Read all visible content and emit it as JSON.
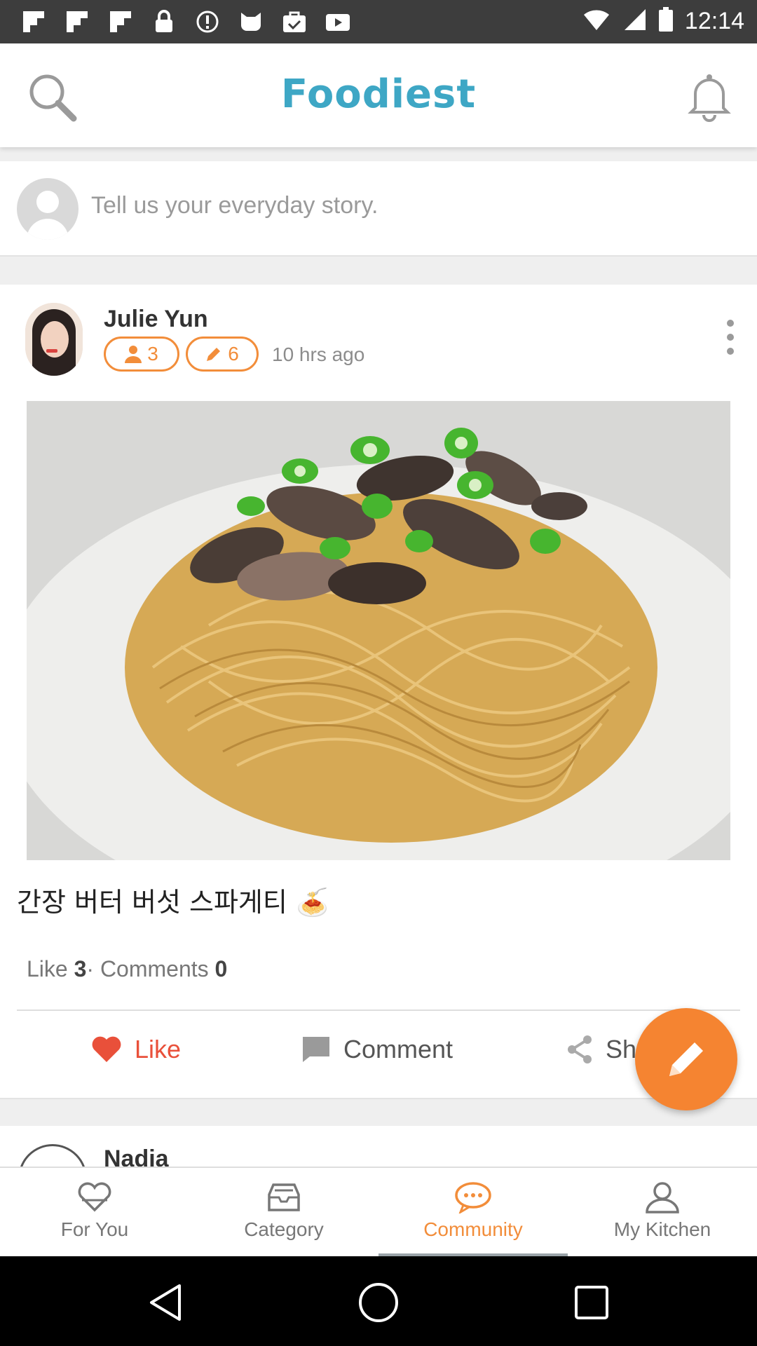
{
  "status_bar": {
    "time": "12:14",
    "notification_icons": [
      "flipboard-icon",
      "flipboard-icon",
      "flipboard-icon",
      "lock-icon",
      "info-icon",
      "cat-icon",
      "bag-icon",
      "youtube-icon"
    ],
    "system_icons": [
      "wifi-icon",
      "signal-icon",
      "battery-icon"
    ]
  },
  "header": {
    "logo_text": "Foodiest",
    "search_icon": "search-icon",
    "bell_icon": "bell-icon",
    "brand_color": "#3ea7c5"
  },
  "composer": {
    "placeholder": "Tell us your everyday story."
  },
  "post": {
    "author_name": "Julie Yun",
    "followers_count": "3",
    "posts_count": "6",
    "timestamp": "10 hrs ago",
    "caption": "간장 버터 버섯 스파게티",
    "caption_emoji": "🍝",
    "stats": {
      "like_label": "Like",
      "like_count": "3",
      "separator": "·",
      "comments_label": "Comments",
      "comments_count": "0"
    },
    "actions": {
      "like": "Like",
      "comment": "Comment",
      "share": "Sh"
    },
    "accent_color": "#f28d3a"
  },
  "next_post": {
    "author_name": "Nadia"
  },
  "tabs": [
    {
      "label": "For You",
      "icon": "heart-basket-icon",
      "active": false
    },
    {
      "label": "Category",
      "icon": "tray-icon",
      "active": false
    },
    {
      "label": "Community",
      "icon": "chat-bubble-icon",
      "active": true
    },
    {
      "label": "My Kitchen",
      "icon": "person-icon",
      "active": false
    }
  ]
}
